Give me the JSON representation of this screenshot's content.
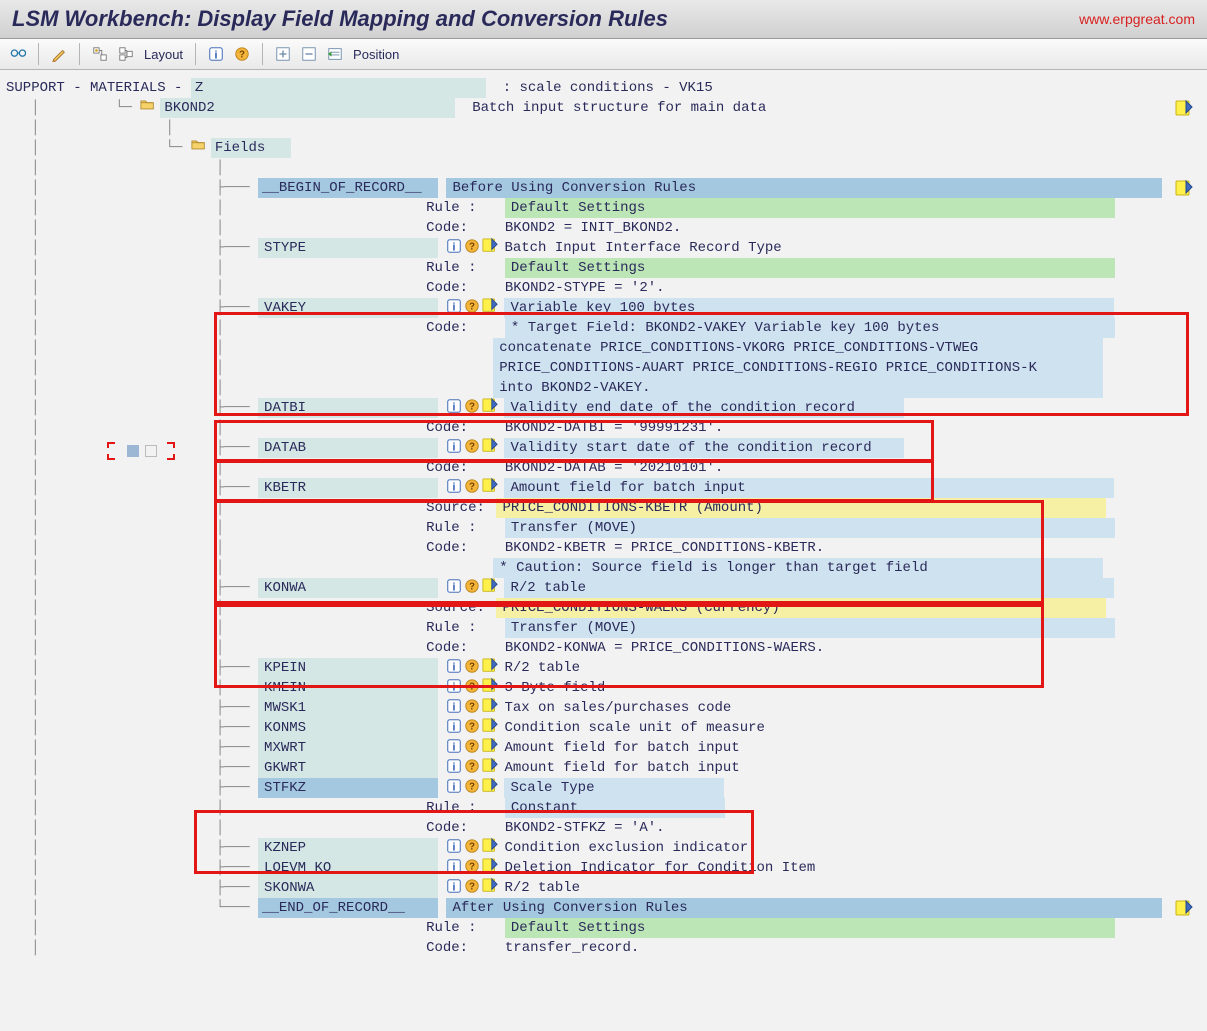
{
  "watermark": "www.erpgreat.com",
  "title": "LSM Workbench: Display Field Mapping and Conversion Rules",
  "toolbar": {
    "layout_label": "Layout",
    "position_label": "Position"
  },
  "breadcrumb": {
    "root": "SUPPORT",
    "mid": "MATERIALS",
    "obj": "Z",
    "obj_suffix": ": scale conditions - VK15"
  },
  "bkond2": {
    "name": "BKOND2",
    "desc": "Batch input structure for main data"
  },
  "fields_label": "Fields",
  "labels": {
    "rule": "Rule :",
    "code": "Code:",
    "source": "Source:"
  },
  "begin": {
    "name": "__BEGIN_OF_RECORD__",
    "banner": "Before Using Conversion Rules",
    "rule": "Default Settings",
    "code": "BKOND2 = INIT_BKOND2."
  },
  "stype": {
    "name": "STYPE",
    "desc": "Batch Input Interface Record Type",
    "rule": "Default Settings",
    "code": "BKOND2-STYPE = '2'."
  },
  "vakey": {
    "name": "VAKEY",
    "desc": "Variable key 100 bytes",
    "code1": "* Target Field: BKOND2-VAKEY Variable key 100 bytes",
    "code2": "concatenate PRICE_CONDITIONS-VKORG PRICE_CONDITIONS-VTWEG",
    "code3": "PRICE_CONDITIONS-AUART PRICE_CONDITIONS-REGIO PRICE_CONDITIONS-K",
    "code4": "into BKOND2-VAKEY."
  },
  "datbi": {
    "name": "DATBI",
    "desc": "Validity end date of the condition record",
    "code": "BKOND2-DATBI = '99991231'."
  },
  "datab": {
    "name": "DATAB",
    "desc": "Validity start date of the condition record",
    "code": "BKOND2-DATAB = '20210101'."
  },
  "kbetr": {
    "name": "KBETR",
    "desc": "Amount field for batch input",
    "source": "PRICE_CONDITIONS-KBETR (Amount)",
    "rule": "Transfer (MOVE)",
    "code": "BKOND2-KBETR = PRICE_CONDITIONS-KBETR.",
    "caution": "* Caution: Source field is longer than target field"
  },
  "konwa": {
    "name": "KONWA",
    "desc": "R/2 table",
    "source": "PRICE_CONDITIONS-WAERS (Currency)",
    "rule": "Transfer (MOVE)",
    "code": "BKOND2-KONWA = PRICE_CONDITIONS-WAERS."
  },
  "simple": [
    {
      "name": "KPEIN",
      "desc": "R/2 table"
    },
    {
      "name": "KMEIN",
      "desc": "3-Byte field"
    },
    {
      "name": "MWSK1",
      "desc": "Tax on sales/purchases code"
    },
    {
      "name": "KONMS",
      "desc": "Condition scale unit of measure"
    },
    {
      "name": "MXWRT",
      "desc": "Amount field for batch input"
    },
    {
      "name": "GKWRT",
      "desc": "Amount field for batch input"
    }
  ],
  "stfkz": {
    "name": "STFKZ",
    "desc": "Scale Type",
    "rule": "Constant",
    "code": "BKOND2-STFKZ = 'A'."
  },
  "tail": [
    {
      "name": "KZNEP",
      "desc": "Condition exclusion indicator"
    },
    {
      "name": "LOEVM_KO",
      "desc": "Deletion Indicator for Condition Item"
    },
    {
      "name": "SKONWA",
      "desc": "R/2 table"
    }
  ],
  "end": {
    "name": "__END_OF_RECORD__",
    "banner": "After Using Conversion Rules",
    "rule": "Default Settings",
    "code": "transfer_record."
  }
}
